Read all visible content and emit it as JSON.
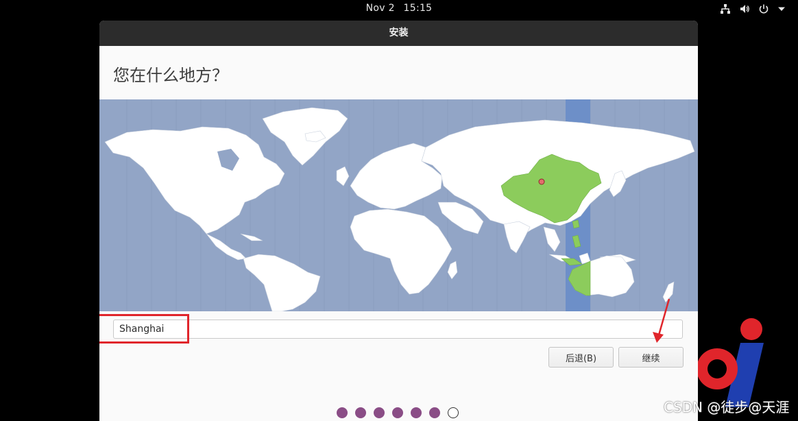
{
  "topbar": {
    "date": "Nov 2",
    "time": "15:15",
    "icons": [
      "network-icon",
      "volume-icon",
      "power-icon",
      "chevron-down-icon"
    ]
  },
  "window": {
    "title": "安装",
    "heading": "您在什么地方？"
  },
  "timezone": {
    "value": "Shanghai"
  },
  "buttons": {
    "back_label": "后退(B)",
    "continue_label": "继续"
  },
  "progress": {
    "total_steps": 7,
    "completed_steps": 6
  },
  "colors": {
    "map_background": "#92a5c6",
    "land": "#ffffff",
    "selected_region": "#8ccc5c",
    "selected_band": "#6d8fc8",
    "progress_dot": "#8a4d86",
    "highlight": "#e0252b"
  },
  "watermark": {
    "text": "CSDN @徒步@天涯"
  }
}
